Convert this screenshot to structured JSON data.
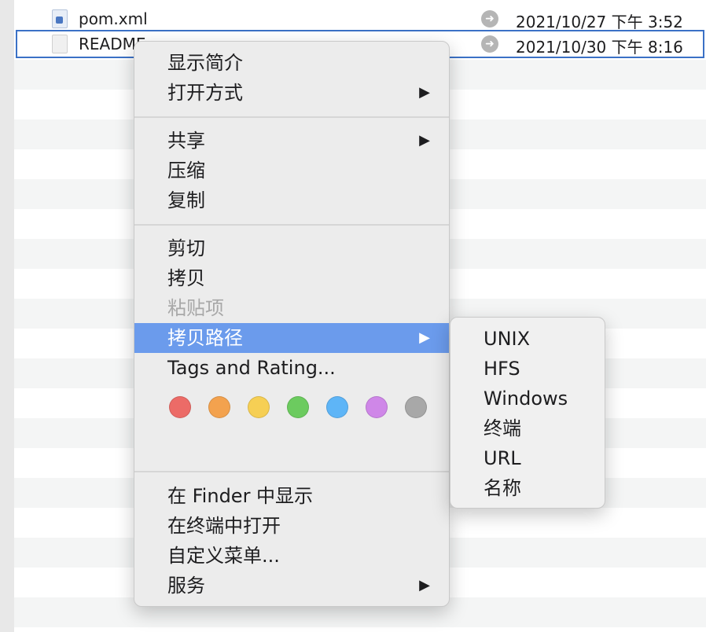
{
  "files": [
    {
      "name": "pom.xml",
      "date": "2021/10/27 下午 3:52",
      "icon": "xml-file-icon",
      "selected": false
    },
    {
      "name": "README",
      "date": "2021/10/30 下午 8:16",
      "icon": "document-icon",
      "selected": true
    }
  ],
  "context_menu": {
    "groups": [
      [
        {
          "label": "显示简介",
          "submenu": false,
          "disabled": false
        },
        {
          "label": "打开方式",
          "submenu": true,
          "disabled": false
        }
      ],
      [
        {
          "label": "共享",
          "submenu": true,
          "disabled": false
        },
        {
          "label": "压缩",
          "submenu": false,
          "disabled": false
        },
        {
          "label": "复制",
          "submenu": false,
          "disabled": false
        }
      ],
      [
        {
          "label": "剪切",
          "submenu": false,
          "disabled": false
        },
        {
          "label": "拷贝",
          "submenu": false,
          "disabled": false
        },
        {
          "label": "粘贴项",
          "submenu": false,
          "disabled": true
        },
        {
          "label": "拷贝路径",
          "submenu": true,
          "disabled": false,
          "highlighted": true
        },
        {
          "label": "Tags and Rating...",
          "submenu": false,
          "disabled": false
        }
      ],
      [
        {
          "label": "在 Finder 中显示",
          "submenu": false,
          "disabled": false
        },
        {
          "label": "在终端中打开",
          "submenu": false,
          "disabled": false
        },
        {
          "label": "自定义菜单...",
          "submenu": false,
          "disabled": false
        },
        {
          "label": "服务",
          "submenu": true,
          "disabled": false
        }
      ]
    ],
    "tag_colors": [
      "#ec6b67",
      "#f3a24e",
      "#f6cf54",
      "#6ccb5f",
      "#5eb5f7",
      "#cf87e8",
      "#a8a8a8"
    ],
    "submenu_arrow": "▶"
  },
  "copy_path_submenu": {
    "items": [
      "UNIX",
      "HFS",
      "Windows",
      "终端",
      "URL",
      "名称"
    ]
  },
  "colors": {
    "highlight": "#6b9bec",
    "selection_border": "#3b71c6"
  }
}
